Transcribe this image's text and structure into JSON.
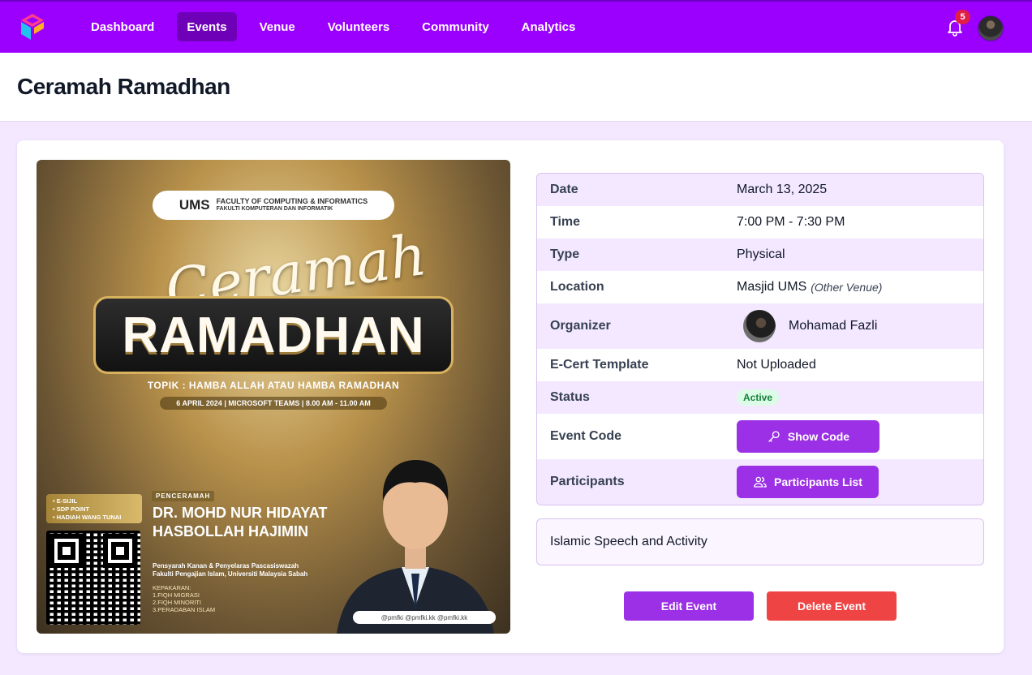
{
  "nav": {
    "items": [
      {
        "label": "Dashboard",
        "active": false
      },
      {
        "label": "Events",
        "active": true
      },
      {
        "label": "Venue",
        "active": false
      },
      {
        "label": "Volunteers",
        "active": false
      },
      {
        "label": "Community",
        "active": false
      },
      {
        "label": "Analytics",
        "active": false
      }
    ],
    "notification_count": "5",
    "brand_color": "#9b00ff"
  },
  "page": {
    "title": "Ceramah Ramadhan"
  },
  "poster": {
    "logo_text": "UMS",
    "faculty_line1": "FACULTY OF COMPUTING & INFORMATICS",
    "faculty_line2": "FAKULTI KOMPUTERAN DAN INFORMATIK",
    "script_title": "Ceramah",
    "main_title": "RAMADHAN",
    "topic": "TOPIK : HAMBA ALLAH ATAU HAMBA RAMADHAN",
    "when": "6 APRIL 2024 | MICROSOFT TEAMS | 8.00 AM - 11.00 AM",
    "perks": [
      "• E-SIJIL",
      "• SDP POINT",
      "• HADIAH WANG TUNAI"
    ],
    "speaker_label": "PENCERAMAH",
    "speaker_line1": "DR. MOHD NUR HIDAYAT",
    "speaker_line2": "HASBOLLAH HAJIMIN",
    "role_line1": "Pensyarah Kanan & Penyelaras Pascasiswazah",
    "role_line2": "Fakulti Pengajian Islam, Universiti Malaysia Sabah",
    "expertise_label": "KEPAKARAN:",
    "expertise": [
      "1.FIQH MIGRASI",
      "2.FIQH MINORITI",
      "3.PERADABAN ISLAM"
    ],
    "socials": "@pmfki  @pmfki.kk  @pmfki.kk"
  },
  "details": {
    "date_label": "Date",
    "date": "March 13, 2025",
    "time_label": "Time",
    "time": "7:00 PM - 7:30 PM",
    "type_label": "Type",
    "type": "Physical",
    "location_label": "Location",
    "location": "Masjid UMS",
    "location_note": "(Other Venue)",
    "organizer_label": "Organizer",
    "organizer": "Mohamad Fazli",
    "ecert_label": "E-Cert Template",
    "ecert": "Not Uploaded",
    "status_label": "Status",
    "status": "Active",
    "code_label": "Event Code",
    "code_button": "Show Code",
    "participants_label": "Participants",
    "participants_button": "Participants List"
  },
  "description": "Islamic Speech and Activity",
  "actions": {
    "edit": "Edit Event",
    "delete": "Delete Event"
  }
}
